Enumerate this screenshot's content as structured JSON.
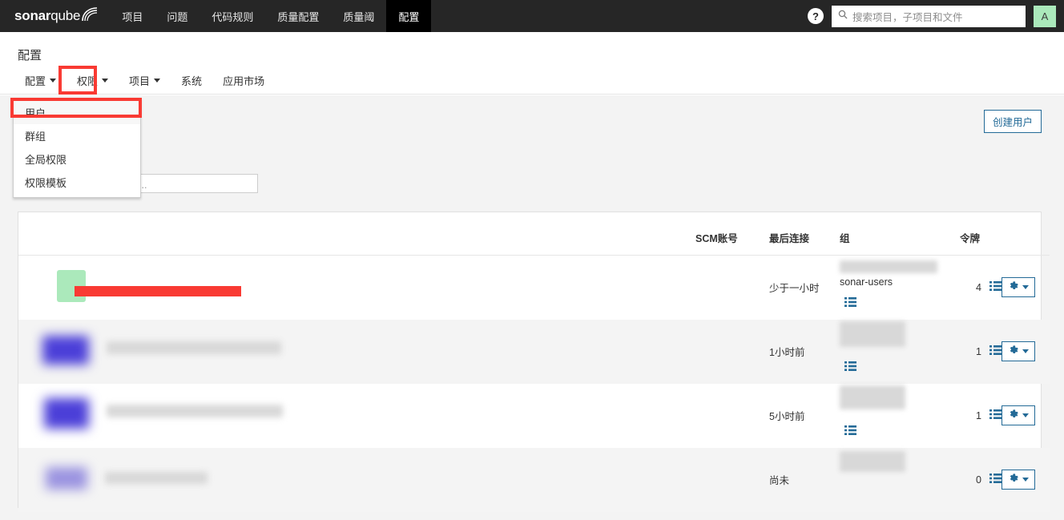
{
  "navbar": {
    "brand": {
      "bold": "sonar",
      "light": "qube"
    },
    "items": [
      {
        "label": "项目",
        "active": false
      },
      {
        "label": "问题",
        "active": false
      },
      {
        "label": "代码规则",
        "active": false
      },
      {
        "label": "质量配置",
        "active": false
      },
      {
        "label": "质量阈",
        "active": false
      },
      {
        "label": "配置",
        "active": true
      }
    ],
    "help_label": "?",
    "search": {
      "placeholder": "搜索项目，子项目和文件",
      "value": ""
    },
    "avatar_initial": "A"
  },
  "context": {
    "title": "配置",
    "subnav": [
      {
        "label": "配置",
        "has_caret": true
      },
      {
        "label": "权限",
        "has_caret": true
      },
      {
        "label": "项目",
        "has_caret": true
      },
      {
        "label": "系统",
        "has_caret": false
      },
      {
        "label": "应用市场",
        "has_caret": false
      }
    ]
  },
  "dropdown": {
    "items": [
      {
        "label": "用户",
        "highlighted": true
      },
      {
        "label": "群组",
        "highlighted": false
      },
      {
        "label": "全局权限",
        "highlighted": false
      },
      {
        "label": "权限模板",
        "highlighted": false
      }
    ]
  },
  "main": {
    "create_user_label": "创建用户",
    "search": {
      "placeholder": "根据登录名或姓名搜索...",
      "value": ""
    }
  },
  "table": {
    "columns": [
      "",
      "SCM账号",
      "最后连接",
      "组",
      "令牌",
      ""
    ],
    "rows": [
      {
        "name": "",
        "scm": "",
        "last_connection": "少于一小时",
        "group_label": "sonar-users",
        "tokens": "4",
        "action_label": ""
      },
      {
        "name": "",
        "scm": "",
        "last_connection": "1小时前",
        "group_label": "",
        "tokens": "1",
        "action_label": ""
      },
      {
        "name": "",
        "scm": "",
        "last_connection": "5小时前",
        "group_label": "",
        "tokens": "1",
        "action_label": ""
      },
      {
        "name": "",
        "scm": "",
        "last_connection": "尚未",
        "group_label": "",
        "tokens": "0",
        "action_label": ""
      }
    ]
  },
  "colors": {
    "navbar_bg": "#262626",
    "active_tab_bg": "#000000",
    "accent_blue": "#236a97",
    "annotation_red": "#f93a33",
    "avatar_green": "#abe9bb",
    "page_bg": "#f3f3f3",
    "row_alt_bg": "#f4f4f4"
  }
}
